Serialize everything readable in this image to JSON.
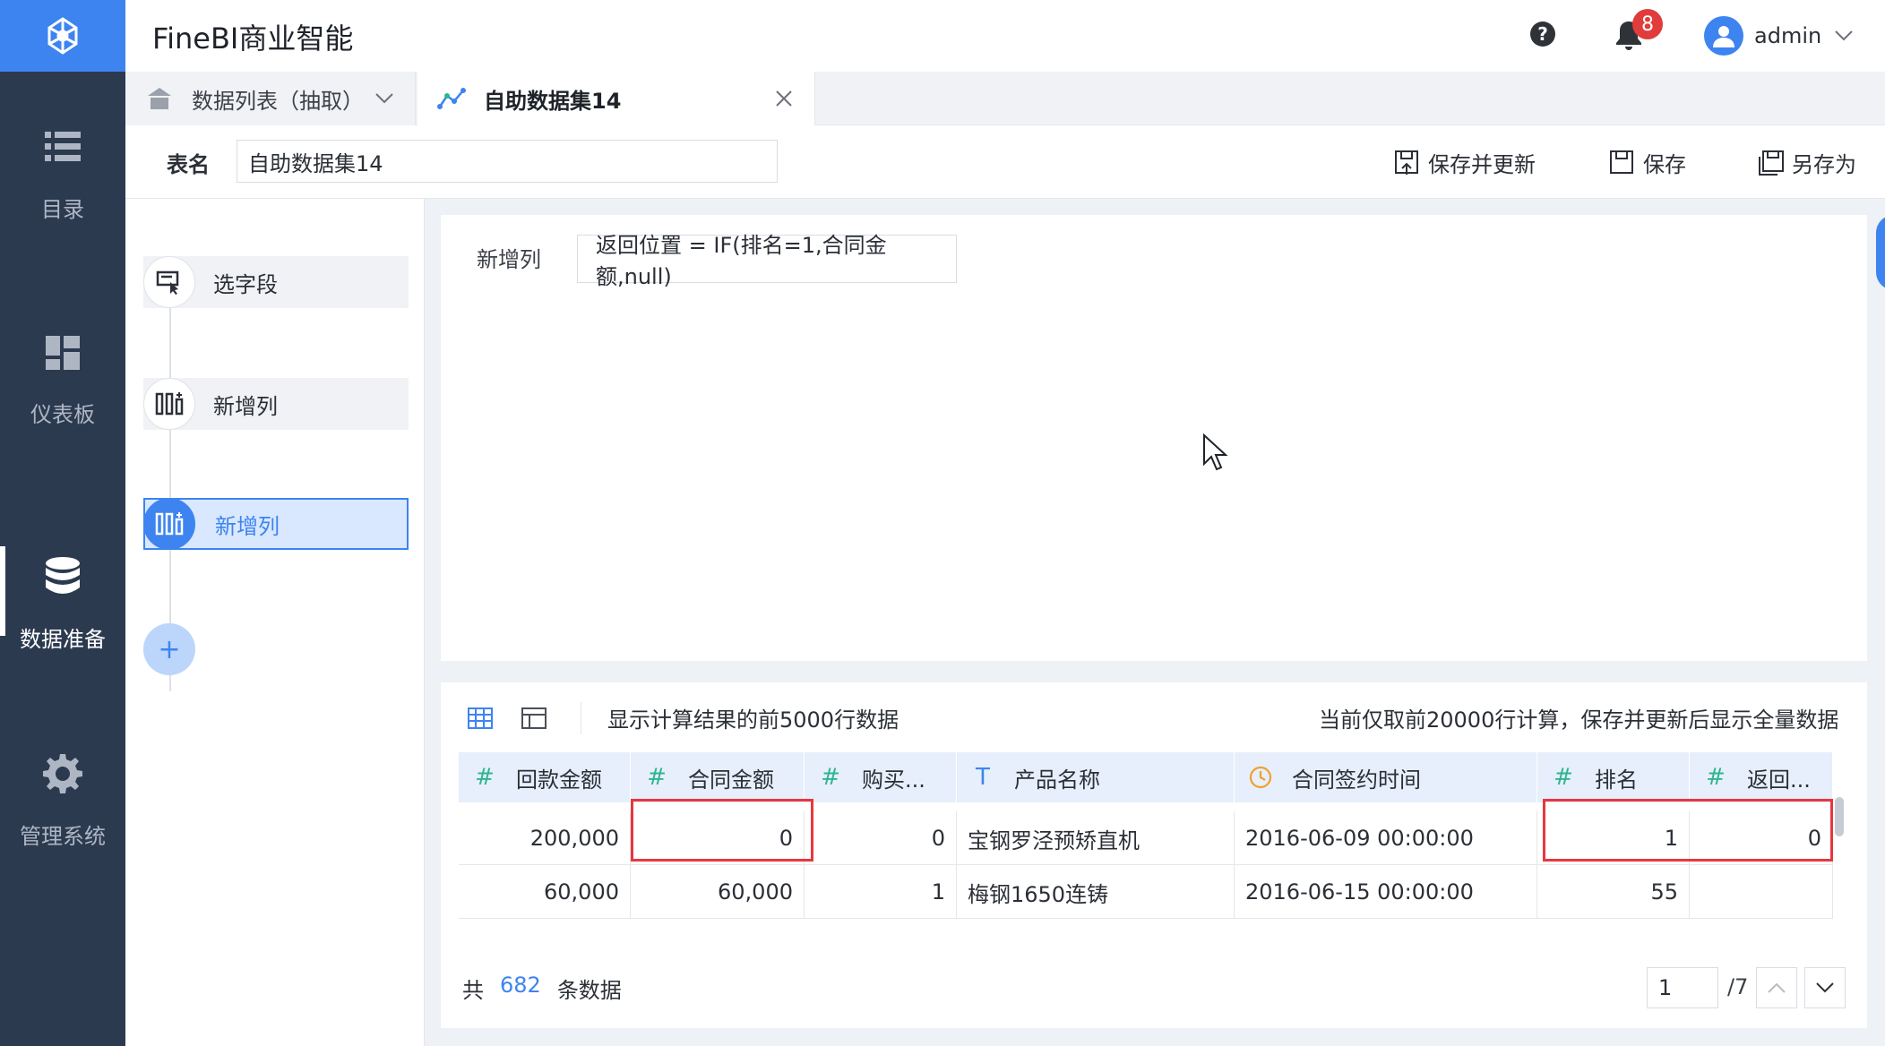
{
  "app": {
    "title": "FineBI商业智能"
  },
  "nav": {
    "items": [
      {
        "label": "目录",
        "icon": "list-icon"
      },
      {
        "label": "仪表板",
        "icon": "dashboard-icon"
      },
      {
        "label": "数据准备",
        "icon": "database-icon",
        "active": true
      },
      {
        "label": "管理系统",
        "icon": "gear-icon"
      }
    ]
  },
  "header": {
    "help": "?",
    "notifications": "8",
    "user": "admin"
  },
  "tabs": [
    {
      "label": "数据列表（抽取）"
    },
    {
      "label": "自助数据集14",
      "active": true
    }
  ],
  "table_name": {
    "label": "表名",
    "value": "自助数据集14"
  },
  "actions": {
    "save_update": "保存并更新",
    "save": "保存",
    "save_as": "另存为"
  },
  "steps": [
    {
      "label": "选字段"
    },
    {
      "label": "新增列"
    },
    {
      "label": "新增列",
      "active": true
    }
  ],
  "add_step": "+",
  "config": {
    "label": "新增列",
    "formula": "返回位置 = IF(排名=1,合同金额,null)"
  },
  "preview": {
    "info_left": "显示计算结果的前5000行数据",
    "info_right": "当前仅取前20000行计算，保存并更新后显示全量数据",
    "columns": [
      {
        "type_icon": "#",
        "name": "回款金额"
      },
      {
        "type_icon": "#",
        "name": "合同金额"
      },
      {
        "type_icon": "#",
        "name": "购买..."
      },
      {
        "type_icon": "T",
        "name": "产品名称"
      },
      {
        "type_icon": "clock",
        "name": "合同签约时间"
      },
      {
        "type_icon": "#",
        "name": "排名"
      },
      {
        "type_icon": "#",
        "name": "返回..."
      }
    ],
    "rows": [
      [
        "200,000",
        "0",
        "0",
        "宝钢罗泾预矫直机",
        "2016-06-09 00:00:00",
        "1",
        "0"
      ],
      [
        "60,000",
        "60,000",
        "1",
        "梅钢1650连铸",
        "2016-06-15 00:00:00",
        "55",
        ""
      ]
    ]
  },
  "footer": {
    "total_prefix": "共",
    "total_count": "682",
    "total_suffix": "条数据",
    "page": "1",
    "pages": "/7"
  },
  "colors": {
    "accent": "#3d84f0",
    "nav_bg": "#2c3a50",
    "highlight": "#e8373e",
    "field_num": "#2fb58f"
  }
}
